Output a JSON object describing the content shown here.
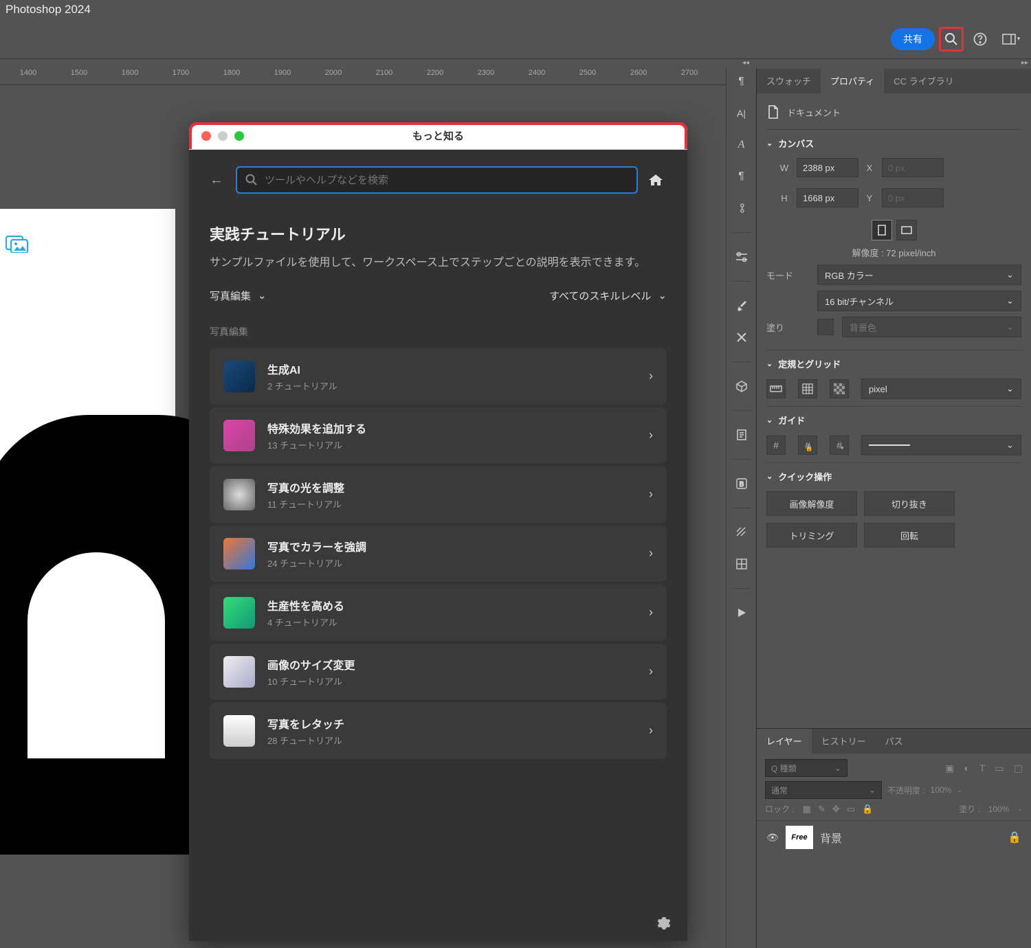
{
  "app_title": "Photoshop 2024",
  "toolbar": {
    "share": "共有"
  },
  "ruler_ticks": [
    "1400",
    "1500",
    "1600",
    "1700",
    "1800",
    "1900",
    "2000",
    "2100",
    "2200",
    "2300",
    "2400",
    "2500",
    "2600",
    "2700"
  ],
  "panel_tabs": {
    "swatches": "スウォッチ",
    "properties": "プロパティ",
    "cc_lib": "CC ライブラリ"
  },
  "properties": {
    "doc_label": "ドキュメント",
    "canvas_section": "カンバス",
    "w_label": "W",
    "w_value": "2388 px",
    "h_label": "H",
    "h_value": "1668 px",
    "x_label": "X",
    "x_value": "0 px",
    "y_label": "Y",
    "y_value": "0 px",
    "resolution": "解像度 : 72 pixel/inch",
    "mode_label": "モード",
    "mode_value": "RGB カラー",
    "depth_value": "16 bit/チャンネル",
    "fill_label": "塗り",
    "fill_value": "背景色",
    "ruler_section": "定規とグリッド",
    "ruler_unit": "pixel",
    "guide_section": "ガイド",
    "quick_section": "クイック操作",
    "quick": {
      "resize": "画像解像度",
      "crop": "切り抜き",
      "trim": "トリミング",
      "rotate": "回転"
    }
  },
  "layers_tabs": {
    "layers": "レイヤー",
    "history": "ヒストリー",
    "paths": "パス"
  },
  "layers": {
    "kind": "Q 種類",
    "blend": "通常",
    "opacity_label": "不透明度 :",
    "opacity": "100%",
    "lock_label": "ロック :",
    "fill_label": "塗り :",
    "fill": "100%",
    "bg_thumb": "Free",
    "bg_name": "背景"
  },
  "modal": {
    "title": "もっと知る",
    "search_placeholder": "ツールやヘルプなどを検索",
    "heading": "実践チュートリアル",
    "description": "サンプルファイルを使用して、ワークスペース上でステップごとの説明を表示できます。",
    "filter_category": "写真編集",
    "filter_level": "すべてのスキルレベル",
    "category_label": "写真編集",
    "tutorials": [
      {
        "name": "生成AI",
        "count": "2 チュートリアル"
      },
      {
        "name": "特殊効果を追加する",
        "count": "13 チュートリアル"
      },
      {
        "name": "写真の光を調整",
        "count": "11 チュートリアル"
      },
      {
        "name": "写真でカラーを強調",
        "count": "24 チュートリアル"
      },
      {
        "name": "生産性を高める",
        "count": "4 チュートリアル"
      },
      {
        "name": "画像のサイズ変更",
        "count": "10 チュートリアル"
      },
      {
        "name": "写真をレタッチ",
        "count": "28 チュートリアル"
      }
    ]
  }
}
